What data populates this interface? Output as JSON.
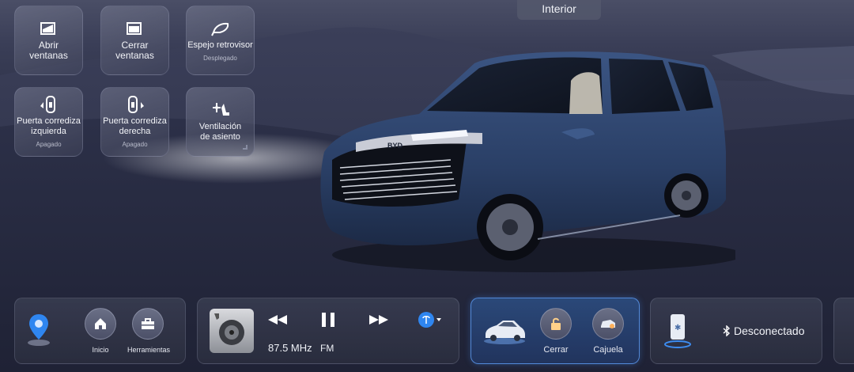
{
  "header": {
    "tab_label": "Interior"
  },
  "controls": [
    {
      "label": "Abrir\nventanas",
      "status": "",
      "icon": "window-open-icon"
    },
    {
      "label": "Cerrar\nventanas",
      "status": "",
      "icon": "window-close-icon"
    },
    {
      "label": "Espejo retrovisor",
      "status": "Desplegado",
      "icon": "mirror-icon"
    },
    {
      "label": "Puerta corrediza\nizquierda",
      "status": "Apagado",
      "icon": "sliding-door-left-icon"
    },
    {
      "label": "Puerta corrediza\nderecha",
      "status": "Apagado",
      "icon": "sliding-door-right-icon"
    },
    {
      "label": "Ventilación\nde asiento",
      "status": "",
      "icon": "seat-ventilation-icon"
    }
  ],
  "dock": {
    "nav": {
      "home_label": "Inicio",
      "tools_label": "Herramientas"
    },
    "media": {
      "frequency": "87.5 MHz",
      "band": "FM"
    },
    "vehicle": {
      "lock_label": "Cerrar",
      "trunk_label": "Cajuela"
    },
    "phone": {
      "status": "Desconectado"
    }
  },
  "colors": {
    "accent": "#3d8cf0",
    "active_border": "#5a96eb",
    "background": "#23273b"
  }
}
